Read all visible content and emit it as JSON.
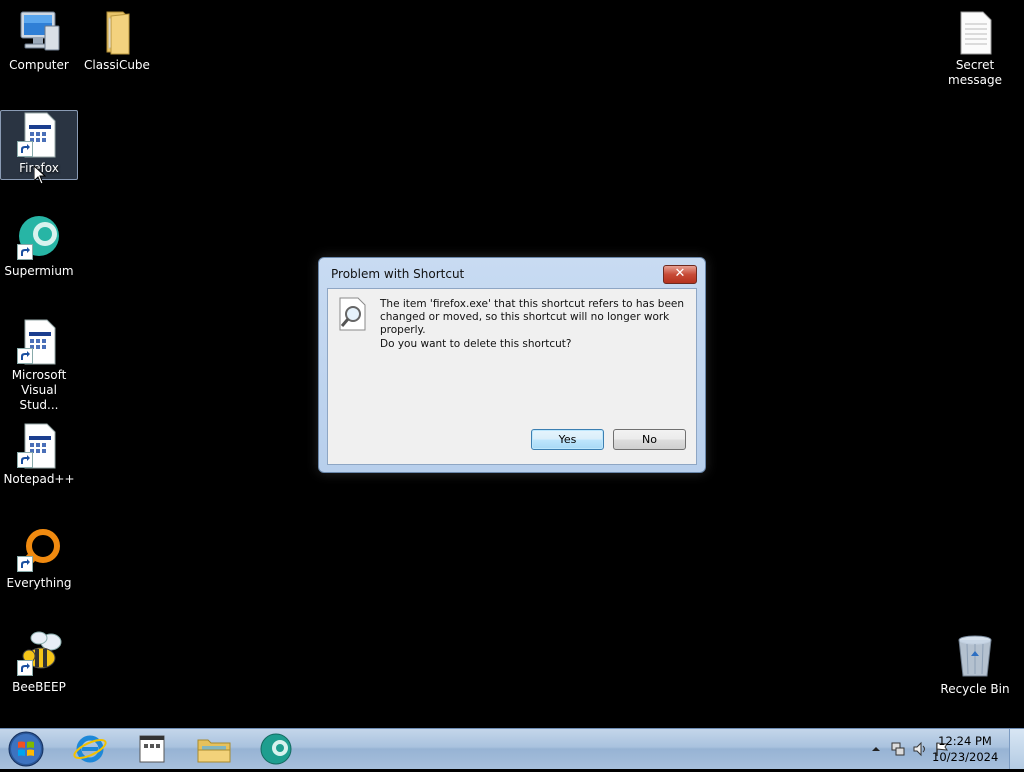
{
  "desktop": {
    "icons": [
      {
        "id": "computer",
        "label": "Computer"
      },
      {
        "id": "classicube",
        "label": "ClassiCube"
      },
      {
        "id": "firefox",
        "label": "Firefox"
      },
      {
        "id": "supermium",
        "label": "Supermium"
      },
      {
        "id": "msvs",
        "label": "Microsoft Visual Stud..."
      },
      {
        "id": "notepadpp",
        "label": "Notepad++"
      },
      {
        "id": "everything",
        "label": "Everything"
      },
      {
        "id": "beebeep",
        "label": "BeeBEEP"
      },
      {
        "id": "secret",
        "label": "Secret message"
      },
      {
        "id": "recycle",
        "label": "Recycle Bin"
      }
    ]
  },
  "dialog": {
    "title": "Problem with Shortcut",
    "close_label": "✕",
    "message": "The item 'firefox.exe' that this shortcut refers to has been changed or moved, so this shortcut will no longer work properly.",
    "question": "Do you want to delete this shortcut?",
    "yes_label": "Yes",
    "no_label": "No"
  },
  "taskbar": {
    "clock_time": "12:24 PM",
    "clock_date": "10/23/2024",
    "pinned": [
      "internet-explorer",
      "application",
      "file-explorer",
      "supermium"
    ]
  },
  "colors": {
    "desktop_bg": "#000000",
    "dialog_frame": "#c8dbf2",
    "close_button": "#c74b37",
    "default_button": "#bee6fd"
  }
}
